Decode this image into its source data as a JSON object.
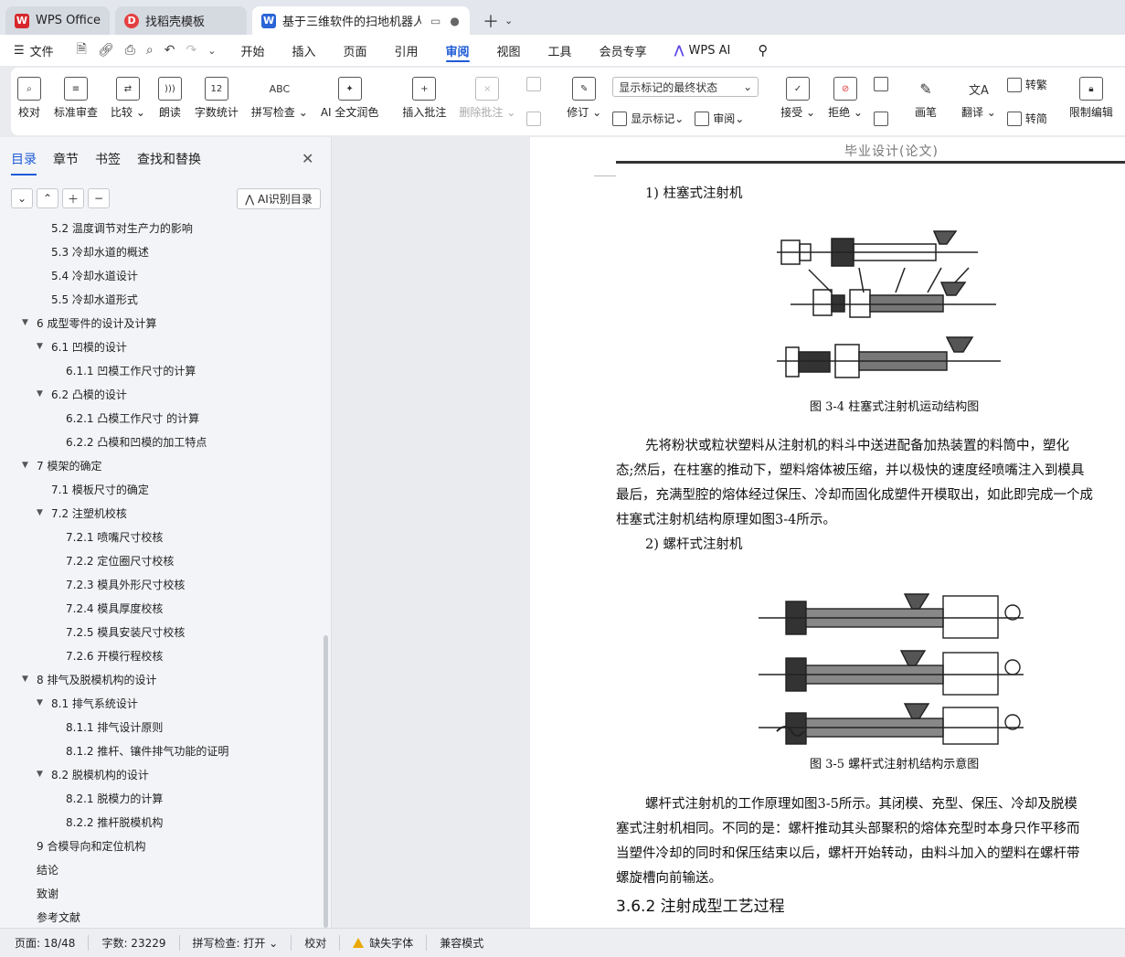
{
  "tabs": [
    {
      "label": "WPS Office",
      "icon": "wps-logo-icon",
      "color": "#d7272c"
    },
    {
      "label": "找稻壳模板",
      "icon": "docer-logo-icon",
      "color": "#e43f3f"
    },
    {
      "label": "基于三维软件的扫地机器人万",
      "icon": "word-doc-icon",
      "color": "#2a64d6"
    }
  ],
  "menu": {
    "file": "文件",
    "items": [
      "开始",
      "插入",
      "页面",
      "引用",
      "审阅",
      "视图",
      "工具",
      "会员专享"
    ],
    "active": "审阅",
    "wps_ai": "WPS AI"
  },
  "ribbon": {
    "proof": "校对",
    "std_review": "标准审查",
    "compare": "比较",
    "read_aloud": "朗读",
    "word_count": "字数统计",
    "spell_check": "拼写检查",
    "ai_polish": "AI 全文润色",
    "insert_comment": "插入批注",
    "delete_comment": "删除批注",
    "track": "修订",
    "markup_select": "显示标记的最终状态",
    "show_markup": "显示标记",
    "review": "审阅",
    "accept": "接受",
    "reject": "拒绝",
    "ink": "画笔",
    "translate": "翻译",
    "to_trad": "转繁",
    "to_simp": "转简",
    "restrict": "限制编辑",
    "doc_cut": "文"
  },
  "panel": {
    "tabs": [
      "目录",
      "章节",
      "书签",
      "查找和替换"
    ],
    "ai_toc": "AI识别目录",
    "toc": [
      {
        "text": "5.2  温度调节对生产力的影响",
        "level": 2,
        "tri": false
      },
      {
        "text": "5.3  冷却水道的概述",
        "level": 2,
        "tri": false
      },
      {
        "text": "5.4  冷却水道设计",
        "level": 2,
        "tri": false
      },
      {
        "text": "5.5  冷却水道形式",
        "level": 2,
        "tri": false
      },
      {
        "text": "6  成型零件的设计及计算",
        "level": 1,
        "tri": true
      },
      {
        "text": "6.1  凹模的设计",
        "level": 2,
        "tri": true
      },
      {
        "text": "6.1.1  凹模工作尺寸的计算",
        "level": 3,
        "tri": false
      },
      {
        "text": "6.2  凸模的设计",
        "level": 2,
        "tri": true
      },
      {
        "text": "6.2.1  凸模工作尺寸 的计算",
        "level": 3,
        "tri": false
      },
      {
        "text": "6.2.2  凸模和凹模的加工特点",
        "level": 3,
        "tri": false
      },
      {
        "text": "7  模架的确定",
        "level": 1,
        "tri": true
      },
      {
        "text": "7.1  模板尺寸的确定",
        "level": 2,
        "tri": false
      },
      {
        "text": "7.2  注塑机校核",
        "level": 2,
        "tri": true
      },
      {
        "text": "7.2.1  喷嘴尺寸校核",
        "level": 3,
        "tri": false
      },
      {
        "text": "7.2.2  定位圈尺寸校核",
        "level": 3,
        "tri": false
      },
      {
        "text": "7.2.3  模具外形尺寸校核",
        "level": 3,
        "tri": false
      },
      {
        "text": "7.2.4  模具厚度校核",
        "level": 3,
        "tri": false
      },
      {
        "text": "7.2.5  模具安装尺寸校核",
        "level": 3,
        "tri": false
      },
      {
        "text": "7.2.6  开模行程校核",
        "level": 3,
        "tri": false
      },
      {
        "text": "8  排气及脱模机构的设计",
        "level": 1,
        "tri": true
      },
      {
        "text": "8.1  排气系统设计",
        "level": 2,
        "tri": true
      },
      {
        "text": "8.1.1  排气设计原则",
        "level": 3,
        "tri": false
      },
      {
        "text": "8.1.2  推杆、镶件排气功能的证明",
        "level": 3,
        "tri": false
      },
      {
        "text": "8.2  脱模机构的设计",
        "level": 2,
        "tri": true
      },
      {
        "text": "8.2.1  脱模力的计算",
        "level": 3,
        "tri": false
      },
      {
        "text": "8.2.2  推杆脱模机构",
        "level": 3,
        "tri": false
      },
      {
        "text": "9  合模导向和定位机构",
        "level": 1,
        "tri": false
      },
      {
        "text": "结论",
        "level": 1,
        "tri": false
      },
      {
        "text": "致谢",
        "level": 1,
        "tri": false
      },
      {
        "text": "参考文献",
        "level": 1,
        "tri": false
      }
    ]
  },
  "document": {
    "header": "毕业设计(论文)",
    "sub1": "1) 柱塞式注射机",
    "fig1_caption": "图 3-4  柱塞式注射机运动结构图",
    "para1": [
      "先将粉状或粒状塑料从注射机的料斗中送进配备加热装置的料筒中，塑化",
      "态;然后，在柱塞的推动下，塑料熔体被压缩，并以极快的速度经喷嘴注入到模具",
      "最后，充满型腔的熔体经过保压、冷却而固化成塑件开模取出，如此即完成一个成",
      "柱塞式注射机结构原理如图3-4所示。"
    ],
    "sub2": "2) 螺杆式注射机",
    "fig2_caption": "图 3-5  螺杆式注射机结构示意图",
    "para2": [
      "螺杆式注射机的工作原理如图3-5所示。其闭模、充型、保压、冷却及脱模",
      "塞式注射机相同。不同的是：螺杆推动其头部聚积的熔体充型时本身只作平移而",
      "当塑件冷却的同时和保压结束以后，螺杆开始转动，由料斗加入的塑料在螺杆带",
      "螺旋槽向前输送。"
    ],
    "heading": "3.6.2  注射成型工艺过程"
  },
  "status": {
    "page": "页面: 18/48",
    "words": "字数: 23229",
    "spell": "拼写检查: 打开",
    "proof": "校对",
    "missing_font": "缺失字体",
    "compat": "兼容模式"
  }
}
